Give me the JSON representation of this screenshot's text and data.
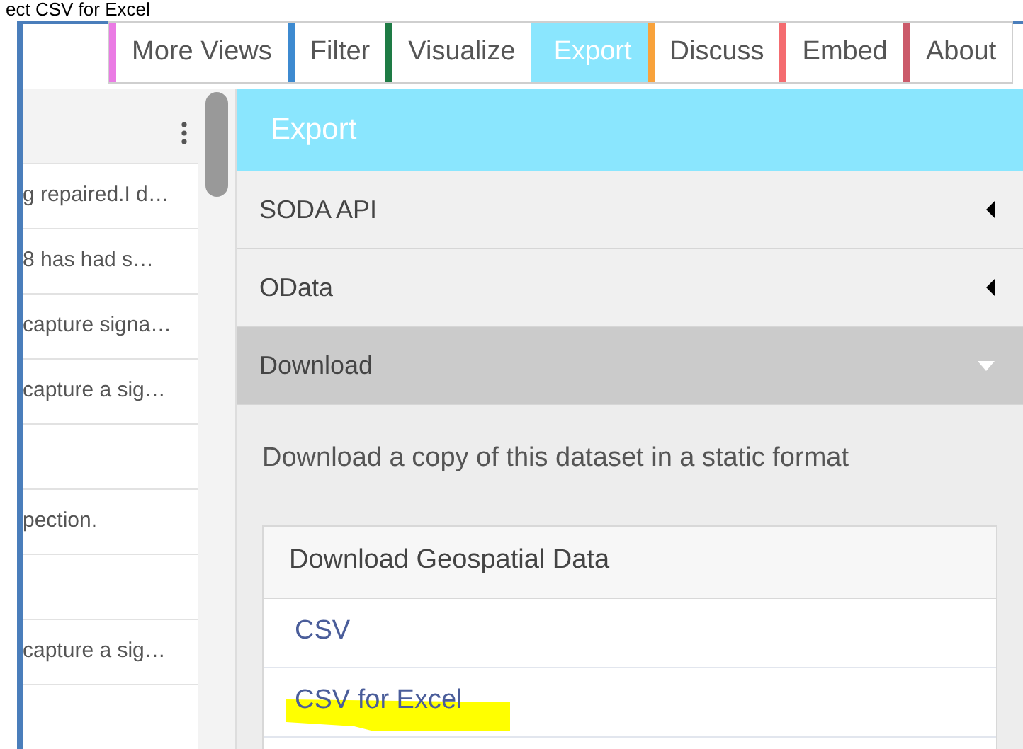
{
  "caption": "ect CSV for Excel",
  "tabs": [
    {
      "label": "More Views",
      "color": "#ea7be4",
      "selected": false
    },
    {
      "label": "Filter",
      "color": "#3d8ad0",
      "selected": false
    },
    {
      "label": "Visualize",
      "color": "#1e7b45",
      "selected": false
    },
    {
      "label": "Export",
      "color": "#8ae6fe",
      "selected": true
    },
    {
      "label": "Discuss",
      "color": "#f8a23b",
      "selected": false
    },
    {
      "label": "Embed",
      "color": "#f46c70",
      "selected": false
    },
    {
      "label": "About",
      "color": "#cb5a6a",
      "selected": false
    }
  ],
  "table_rows": [
    {
      "text": "g repaired.I d…"
    },
    {
      "text": "8 has had s…"
    },
    {
      "text": "capture signa…"
    },
    {
      "text": "capture a sig…"
    },
    {},
    {
      "text": "pection."
    },
    {},
    {
      "text": "capture a sig…"
    },
    {}
  ],
  "export_panel": {
    "title": "Export",
    "sections": [
      {
        "label": "SODA API",
        "expanded": false
      },
      {
        "label": "OData",
        "expanded": false
      },
      {
        "label": "Download",
        "expanded": true
      }
    ],
    "description": "Download a copy of this dataset in a static format",
    "card_title": "Download Geospatial Data",
    "links": [
      {
        "label": "CSV",
        "highlighted": false
      },
      {
        "label": "CSV for Excel",
        "highlighted": true
      }
    ]
  }
}
